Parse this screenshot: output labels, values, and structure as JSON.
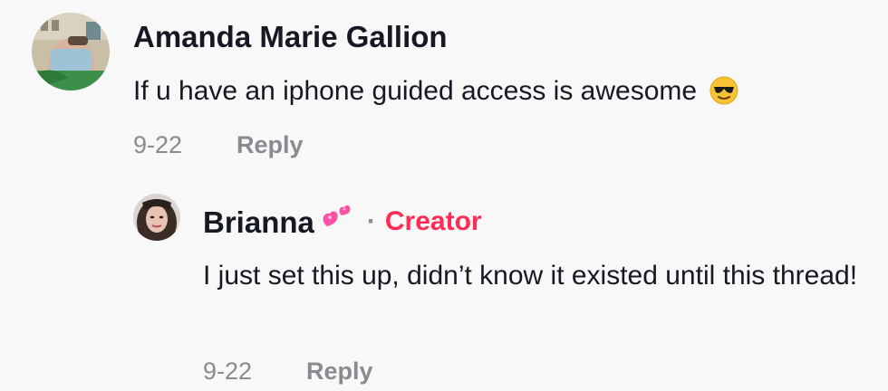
{
  "comment": {
    "username": "Amanda Marie Gallion",
    "text": "If u have an iphone guided access is awesome",
    "emoji": "sunglasses-smiling-face",
    "date": "9-22",
    "reply_label": "Reply"
  },
  "reply": {
    "username": "Brianna",
    "name_emoji": "two-hearts",
    "separator": "·",
    "badge": "Creator",
    "text": "I just set this up, didn’t know it existed until this thread!",
    "date": "9-22",
    "reply_label": "Reply"
  },
  "colors": {
    "background": "#f8f8f8",
    "text": "#161823",
    "muted": "#8a8b91",
    "creator": "#fe2c55"
  }
}
